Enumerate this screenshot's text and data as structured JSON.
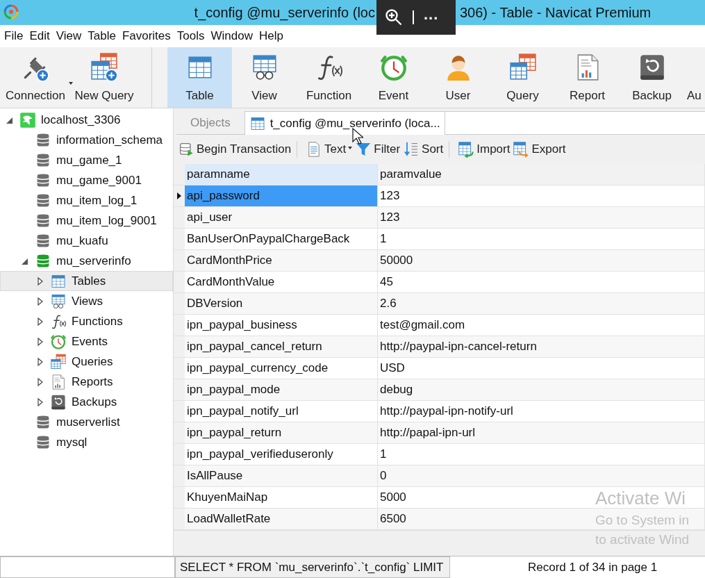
{
  "window": {
    "title_left": "t_config @mu_serverinfo (loc",
    "title_right": "306) - Table - Navicat Premium"
  },
  "viewer_overlay": {
    "more": "..."
  },
  "menu": [
    "File",
    "Edit",
    "View",
    "Table",
    "Favorites",
    "Tools",
    "Window",
    "Help"
  ],
  "toolbar": [
    {
      "label": "Connection",
      "kind": "connection",
      "selected": false,
      "dropdown": true,
      "separator_after": false
    },
    {
      "label": "New Query",
      "kind": "newquery",
      "selected": false,
      "dropdown": false,
      "separator_after": true
    },
    {
      "label": "Table",
      "kind": "table",
      "selected": true,
      "dropdown": false,
      "separator_after": false
    },
    {
      "label": "View",
      "kind": "view",
      "selected": false,
      "dropdown": false,
      "separator_after": false
    },
    {
      "label": "Function",
      "kind": "function",
      "selected": false,
      "dropdown": false,
      "separator_after": false
    },
    {
      "label": "Event",
      "kind": "event",
      "selected": false,
      "dropdown": false,
      "separator_after": false
    },
    {
      "label": "User",
      "kind": "user",
      "selected": false,
      "dropdown": false,
      "separator_after": false
    },
    {
      "label": "Query",
      "kind": "query",
      "selected": false,
      "dropdown": false,
      "separator_after": false
    },
    {
      "label": "Report",
      "kind": "report",
      "selected": false,
      "dropdown": false,
      "separator_after": false
    },
    {
      "label": "Backup",
      "kind": "backup",
      "selected": false,
      "dropdown": false,
      "separator_after": false
    },
    {
      "label": "Au",
      "kind": "cut",
      "selected": false,
      "dropdown": false,
      "separator_after": false
    }
  ],
  "tree": [
    {
      "label": "localhost_3306",
      "kind": "server",
      "expanded": true,
      "selected": false,
      "children": [
        {
          "label": "information_schema",
          "kind": "db",
          "selected": false
        },
        {
          "label": "mu_game_1",
          "kind": "db",
          "selected": false
        },
        {
          "label": "mu_game_9001",
          "kind": "db",
          "selected": false
        },
        {
          "label": "mu_item_log_1",
          "kind": "db",
          "selected": false
        },
        {
          "label": "mu_item_log_9001",
          "kind": "db",
          "selected": false
        },
        {
          "label": "mu_kuafu",
          "kind": "db",
          "selected": false
        },
        {
          "label": "mu_serverinfo",
          "kind": "dbopen",
          "expanded": true,
          "selected": false,
          "children": [
            {
              "label": "Tables",
              "kind": "table",
              "expanded": false,
              "selected": true
            },
            {
              "label": "Views",
              "kind": "view",
              "expanded": false,
              "selected": false
            },
            {
              "label": "Functions",
              "kind": "function",
              "expanded": false,
              "selected": false
            },
            {
              "label": "Events",
              "kind": "event",
              "expanded": false,
              "selected": false
            },
            {
              "label": "Queries",
              "kind": "query",
              "expanded": false,
              "selected": false
            },
            {
              "label": "Reports",
              "kind": "report",
              "expanded": false,
              "selected": false
            },
            {
              "label": "Backups",
              "kind": "backup",
              "expanded": false,
              "selected": false
            }
          ]
        },
        {
          "label": "muserverlist",
          "kind": "db",
          "selected": false
        },
        {
          "label": "mysql",
          "kind": "db",
          "selected": false
        }
      ]
    }
  ],
  "tabs": [
    {
      "label": "Objects",
      "kind": "plain",
      "selected": false
    },
    {
      "label": "t_config @mu_serverinfo (loca...",
      "kind": "table",
      "selected": true
    }
  ],
  "grid_toolbar": [
    {
      "label": "Begin Transaction",
      "kind": "transaction",
      "dropdown": false,
      "separator_after": true
    },
    {
      "label": "Text",
      "kind": "text",
      "dropdown": true,
      "separator_after": false
    },
    {
      "label": "Filter",
      "kind": "filter",
      "dropdown": false,
      "separator_after": false
    },
    {
      "label": "Sort",
      "kind": "sort",
      "dropdown": false,
      "separator_after": true
    },
    {
      "label": "Import",
      "kind": "import",
      "dropdown": false,
      "separator_after": false
    },
    {
      "label": "Export",
      "kind": "export",
      "dropdown": false,
      "separator_after": false
    }
  ],
  "table": {
    "columns": [
      {
        "label": "paramname",
        "selected": true
      },
      {
        "label": "paramvalue",
        "selected": false
      }
    ],
    "rows": [
      {
        "cells": [
          "api_password",
          "123"
        ],
        "selected": true
      },
      {
        "cells": [
          "api_user",
          "123"
        ],
        "selected": false
      },
      {
        "cells": [
          "BanUserOnPaypalChargeBack",
          "1"
        ],
        "selected": false
      },
      {
        "cells": [
          "CardMonthPrice",
          "50000"
        ],
        "selected": false
      },
      {
        "cells": [
          "CardMonthValue",
          "45"
        ],
        "selected": false
      },
      {
        "cells": [
          "DBVersion",
          "2.6"
        ],
        "selected": false
      },
      {
        "cells": [
          "ipn_paypal_business",
          "test@gmail.com"
        ],
        "selected": false
      },
      {
        "cells": [
          "ipn_paypal_cancel_return",
          "http://paypal-ipn-cancel-return"
        ],
        "selected": false
      },
      {
        "cells": [
          "ipn_paypal_currency_code",
          "USD"
        ],
        "selected": false
      },
      {
        "cells": [
          "ipn_paypal_mode",
          "debug"
        ],
        "selected": false
      },
      {
        "cells": [
          "ipn_paypal_notify_url",
          "http://paypal-ipn-notify-url"
        ],
        "selected": false
      },
      {
        "cells": [
          "ipn_paypal_return",
          "http://papal-ipn-url"
        ],
        "selected": false
      },
      {
        "cells": [
          "ipn_paypal_verifieduseronly",
          "1"
        ],
        "selected": false
      },
      {
        "cells": [
          "IsAllPause",
          "0"
        ],
        "selected": false
      },
      {
        "cells": [
          "KhuyenMaiNap",
          "5000"
        ],
        "selected": false
      },
      {
        "cells": [
          "LoadWalletRate",
          "6500"
        ],
        "selected": false
      }
    ]
  },
  "status_bar": {
    "sql": "SELECT * FROM `mu_serverinfo`.`t_config` LIMIT",
    "record": "Record 1 of 34 in page 1"
  },
  "os_notice": [
    "Activate Wi",
    "Go to System in",
    "to activate Wind"
  ]
}
